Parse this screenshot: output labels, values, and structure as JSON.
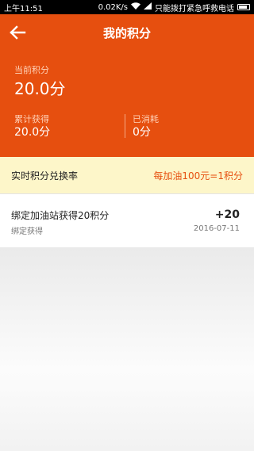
{
  "status_bar": {
    "time": "上午11:51",
    "speed": "0.02K/s",
    "carrier": "只能拨打紧急呼救电话"
  },
  "header": {
    "title": "我的积分"
  },
  "summary": {
    "current_label": "当前积分",
    "current_value": "20.0分",
    "accumulated_label": "累计获得",
    "accumulated_value": "20.0分",
    "used_label": "已消耗",
    "used_value": "0分"
  },
  "rate": {
    "label": "实时积分兑换率",
    "value": "每加油100元=1积分"
  },
  "records": [
    {
      "title": "绑定加油站获得20积分",
      "subtitle": "绑定获得",
      "points": "+20",
      "date": "2016-07-11"
    }
  ],
  "colors": {
    "accent": "#e64f0f",
    "rate_bg": "#fdf6c9"
  }
}
